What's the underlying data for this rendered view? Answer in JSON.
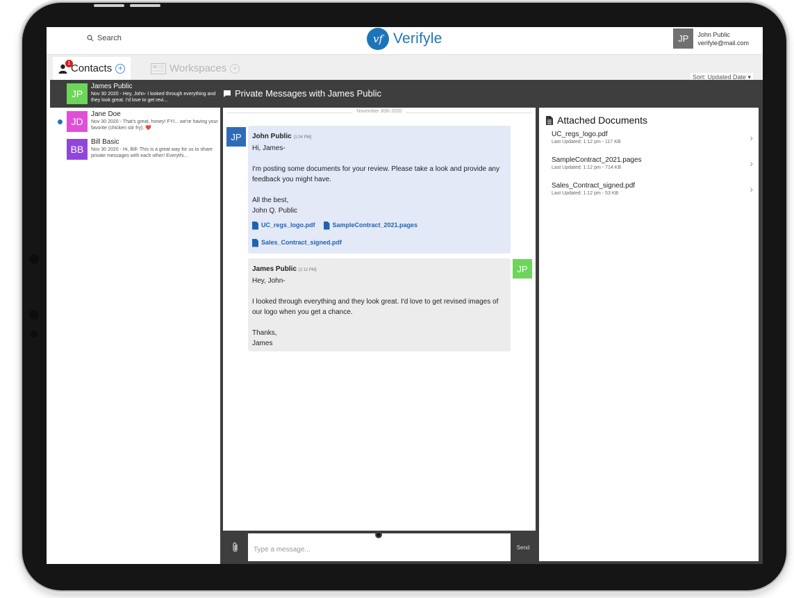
{
  "header": {
    "search_label": "Search",
    "logo_mark": "vf",
    "logo_text": "Verifyle",
    "user": {
      "initials": "JP",
      "name": "John Public",
      "email": "verifyle@mail.com"
    }
  },
  "tabs": [
    {
      "label": "Contacts",
      "badge": "1",
      "active": true
    },
    {
      "label": "Workspaces",
      "active": false
    }
  ],
  "sort_label": "Sort: Updated Date ▾",
  "contacts": [
    {
      "initials": "JP",
      "color": "#6dd55a",
      "name": "James Public",
      "snippet": "Nov 30 2020 - Hey, John- I looked through everything and they look great. I'd love to get revi...",
      "selected": true
    },
    {
      "initials": "JD",
      "color": "#e04fd7",
      "name": "Jane Doe",
      "snippet": "Nov 30 2020 - That's great, honey! FYI... we're having your favorite (chicken stir fry). ❤️",
      "unread": true
    },
    {
      "initials": "BB",
      "color": "#9146db",
      "name": "Bill Basic",
      "snippet": "Nov 30 2020 - Hi, Bill- This is a great way for us to share private messages with each other! Everythi..."
    }
  ],
  "chat": {
    "title": "Private Messages with James Public",
    "date_separator": "November 30th 2020",
    "messages": [
      {
        "initials": "JP",
        "avatar_color": "#2f6cb8",
        "sender": "John Public",
        "time": "[1:04 PM]",
        "lines": [
          "Hi, James-",
          "I'm posting some documents for your review. Please take a look and provide any feedback you might have.",
          "All the best,",
          "John Q. Public"
        ],
        "attachments": [
          "UC_regs_logo.pdf",
          "SampleContract_2021.pages",
          "Sales_Contract_signed.pdf"
        ]
      },
      {
        "initials": "JP",
        "avatar_color": "#6dd55a",
        "sender": "James Public",
        "time": "[1:12 PM]",
        "lines": [
          "Hey, John-",
          "I looked through everything and they look great. I'd love to get revised images of our logo when you get a chance.",
          "Thanks,",
          "James"
        ]
      }
    ],
    "composer_placeholder": "Type a message...",
    "send_label": "Send"
  },
  "docs": {
    "title": "Attached Documents",
    "items": [
      {
        "name": "UC_regs_logo.pdf",
        "meta": "Last Updated: 1:12 pm - 117 KB"
      },
      {
        "name": "SampleContract_2021.pages",
        "meta": "Last Updated: 1:12 pm - 714 KB"
      },
      {
        "name": "Sales_Contract_signed.pdf",
        "meta": "Last Updated: 1:12 pm - 53 KB"
      }
    ]
  }
}
